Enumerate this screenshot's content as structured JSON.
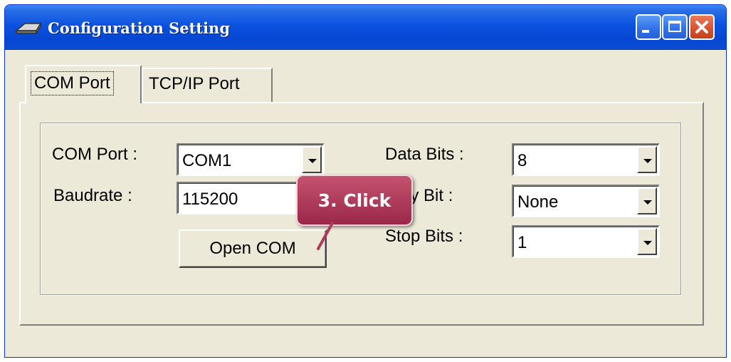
{
  "window": {
    "title": "Configuration Setting"
  },
  "tabs": [
    {
      "label": "COM Port",
      "active": true
    },
    {
      "label": "TCP/IP Port",
      "active": false
    }
  ],
  "com_settings": {
    "com_port": {
      "label": "COM Port :",
      "value": "COM1"
    },
    "baudrate": {
      "label": "Baudrate :",
      "value": "115200"
    },
    "open_button": "Open COM",
    "data_bits": {
      "label": "Data Bits :",
      "value": "8"
    },
    "parity_bit": {
      "label": "Parity Bit :",
      "value": "None"
    },
    "stop_bits": {
      "label": "Stop Bits :",
      "value": "1"
    }
  },
  "annotation": {
    "label": "3. Click",
    "color": "#b03a5b"
  }
}
